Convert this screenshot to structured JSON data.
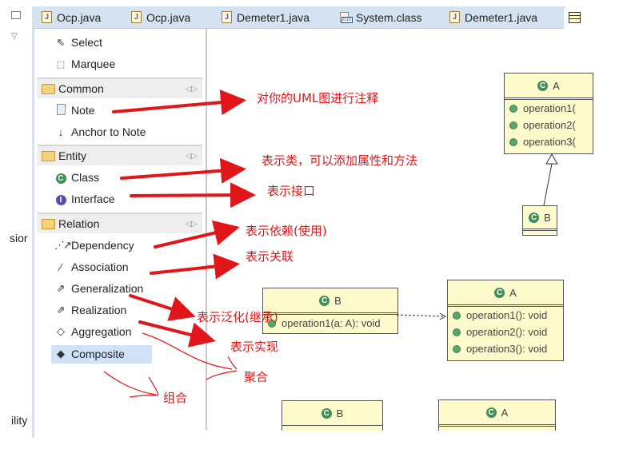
{
  "left_stub": {
    "partial_labels": [
      "sior",
      "ility"
    ]
  },
  "tabs": [
    {
      "label": "Ocp.java",
      "icon": "java-file-icon"
    },
    {
      "label": "Ocp.java",
      "icon": "java-file-icon"
    },
    {
      "label": "Demeter1.java",
      "icon": "java-file-icon"
    },
    {
      "label": "System.class",
      "icon": "class-file-icon"
    },
    {
      "label": "Demeter1.java",
      "icon": "java-file-icon"
    }
  ],
  "palette": {
    "tools": [
      {
        "label": "Select",
        "icon": "cursor-arrow-icon"
      },
      {
        "label": "Marquee",
        "icon": "marquee-icon"
      }
    ],
    "drawers": [
      {
        "label": "Common",
        "items": [
          {
            "label": "Note",
            "icon": "note-icon"
          },
          {
            "label": "Anchor to Note",
            "icon": "anchor-arrow-icon"
          }
        ]
      },
      {
        "label": "Entity",
        "items": [
          {
            "label": "Class",
            "icon": "class-icon"
          },
          {
            "label": "Interface",
            "icon": "interface-icon"
          }
        ]
      },
      {
        "label": "Relation",
        "items": [
          {
            "label": "Dependency",
            "icon": "dependency-icon"
          },
          {
            "label": "Association",
            "icon": "association-icon"
          },
          {
            "label": "Generalization",
            "icon": "generalization-icon"
          },
          {
            "label": "Realization",
            "icon": "realization-icon"
          },
          {
            "label": "Aggregation",
            "icon": "aggregation-icon"
          },
          {
            "label": "Composite",
            "icon": "composite-icon",
            "selected": true
          }
        ]
      }
    ]
  },
  "annotations": {
    "note": "对你的UML图进行注释",
    "class": "表示类，可以添加属性和方法",
    "interface": "表示接口",
    "dependency": "表示依赖(使用)",
    "association": "表示关联",
    "generalization": "表示泛化(继承)",
    "realization": "表示实现",
    "aggregation": "聚合",
    "composite": "组合"
  },
  "diagram": {
    "top_a": {
      "name": "A",
      "ops": [
        "operation1(",
        "operation2(",
        "operation3("
      ]
    },
    "top_b": {
      "name": "B"
    },
    "mid_b": {
      "name": "B",
      "ops": [
        "operation1(a: A): void"
      ]
    },
    "mid_a": {
      "name": "A",
      "ops": [
        "operation1(): void",
        "operation2(): void",
        "operation3(): void"
      ]
    },
    "bot_b": {
      "name": "B"
    },
    "bot_a": {
      "name": "A"
    }
  },
  "colors": {
    "annotation": "#e0161a",
    "uml_fill": "#fdfbcb",
    "tab_bar": "#d4e2f1",
    "selection": "#cfe2f7"
  }
}
